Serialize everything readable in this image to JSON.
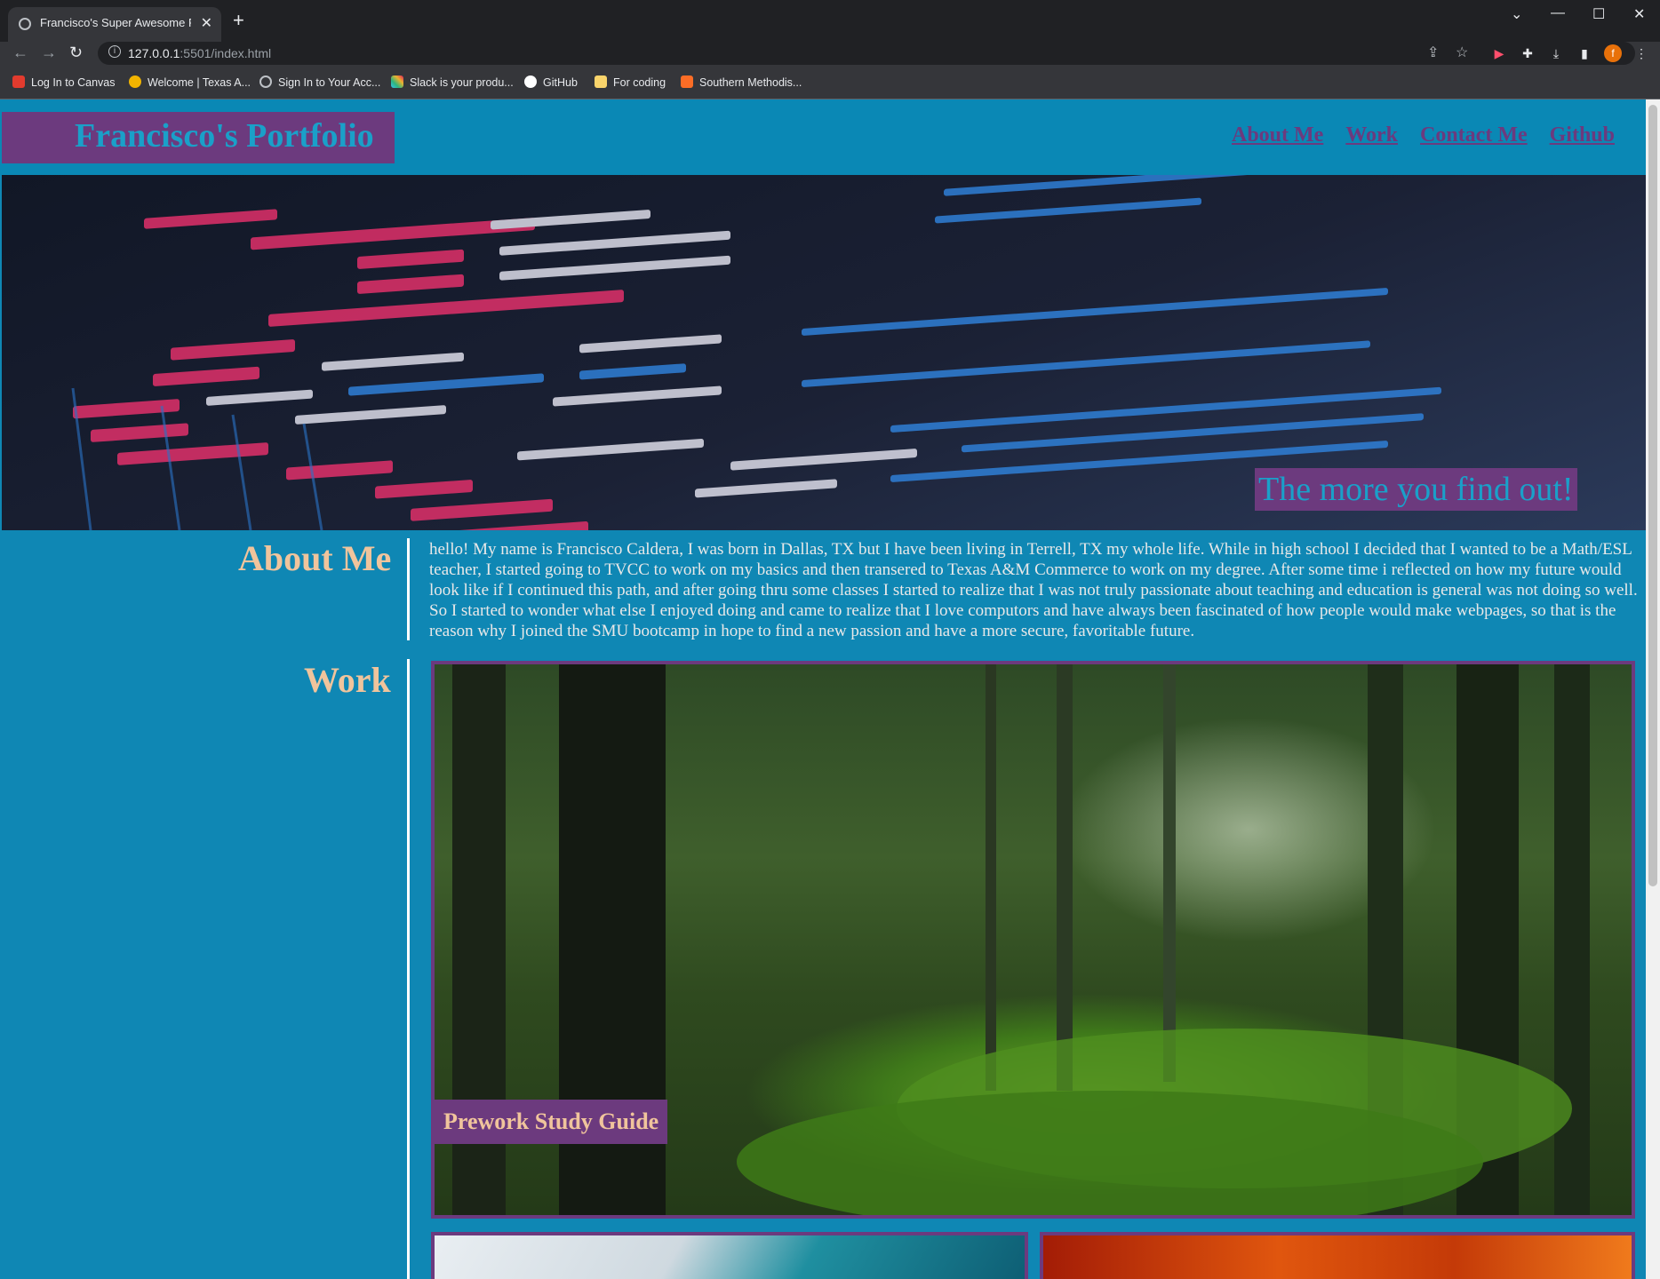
{
  "browser": {
    "tab_title": "Francisco's Super Awesome Portfolio",
    "tab_close": "✕",
    "new_tab": "+",
    "window_controls": [
      "⌄",
      "—",
      "☐",
      "✕"
    ],
    "nav_buttons": [
      "←",
      "→",
      "↻"
    ],
    "url_host": "127.0.0.1",
    "url_rest": ":5501/index.html",
    "bookmarks": [
      {
        "label": "Log In to Canvas",
        "icon": "canvas-icon",
        "color": "#e23b2e"
      },
      {
        "label": "Welcome | Texas A...",
        "icon": "tamuc-icon",
        "color": "#f2b400"
      },
      {
        "label": "Sign In to Your Acc...",
        "icon": "globe-icon",
        "color": "#9aa0a6"
      },
      {
        "label": "Slack is your produ...",
        "icon": "slack-icon",
        "color": "#36c5f0"
      },
      {
        "label": "GitHub",
        "icon": "github-icon",
        "color": "#ffffff"
      },
      {
        "label": "For coding",
        "icon": "folder-icon",
        "color": "#f9d46b"
      },
      {
        "label": "Southern Methodis...",
        "icon": "gitlab-icon",
        "color": "#fc6d26"
      }
    ],
    "profile_initial": "f"
  },
  "site": {
    "brand": "Francisco's Portfolio",
    "nav": [
      "About Me",
      "Work",
      "Contact Me",
      "Github"
    ],
    "hero_tagline": "The more you find out!",
    "about": {
      "title": "About Me",
      "text": "hello! My name is Francisco Caldera, I was born in Dallas, TX but I have been living in Terrell, TX my whole life. While in high school I decided that I wanted to be a Math/ESL teacher, I started going to TVCC to work on my basics and then transered to Texas A&M Commerce to work on my degree. After some time i reflected on how my future would look like if I continued this path, and after going thru some classes I started to realize that I was not truly passionate about teaching and education is general was not doing so well. So I started to wonder what else I enjoyed doing and came to realize that I love computors and have always been fascinated of how people would make webpages, so that is the reason why I joined the SMU bootcamp in hope to find a new passion and have a more secure, favoritable future."
    },
    "work": {
      "title": "Work",
      "featured_label": "Prework Study Guide"
    }
  },
  "colors": {
    "page_bg": "#0f87b4",
    "accent_purple": "#6c3a7e",
    "heading_tan": "#f0c49c",
    "brand_blue": "#1aa0c9"
  }
}
